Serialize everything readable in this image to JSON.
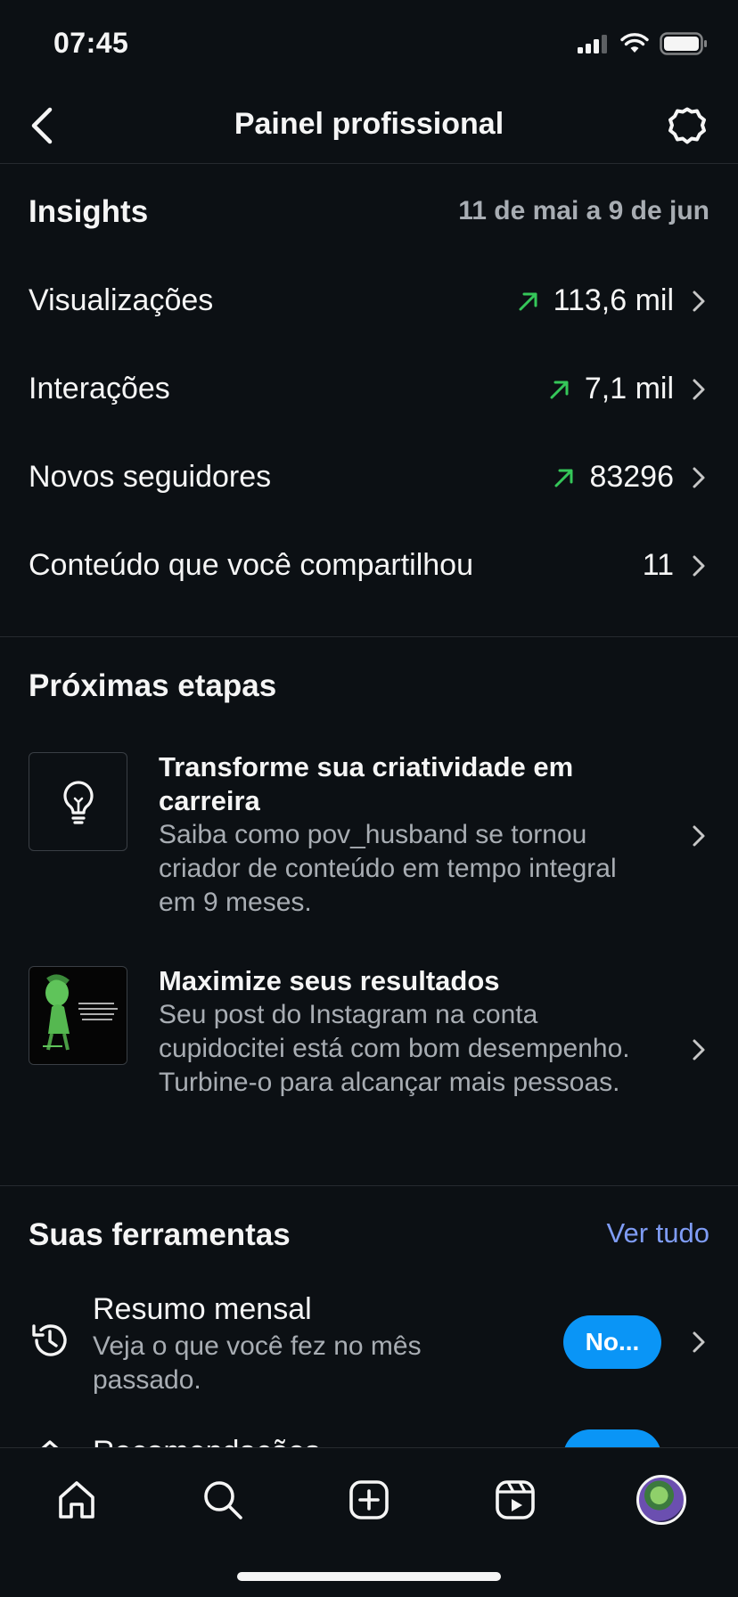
{
  "status_bar": {
    "time": "07:45"
  },
  "header": {
    "title": "Painel profissional"
  },
  "insights": {
    "heading": "Insights",
    "date_range": "11 de mai a 9 de jun",
    "metrics": [
      {
        "label": "Visualizações",
        "value": "113,6 mil",
        "trend": "up"
      },
      {
        "label": "Interações",
        "value": "7,1 mil",
        "trend": "up"
      },
      {
        "label": "Novos seguidores",
        "value": "83296",
        "trend": "up"
      },
      {
        "label": "Conteúdo que você compartilhou",
        "value": "11",
        "trend": "none"
      }
    ]
  },
  "next_steps": {
    "heading": "Próximas etapas",
    "cards": [
      {
        "title": "Transforme sua criatividade em carreira",
        "description": "Saiba como pov_husband se tornou criador de conteúdo em tempo integral em 9 meses.",
        "icon": "lightbulb-icon"
      },
      {
        "title": "Maximize seus resultados",
        "description": "Seu post do Instagram na conta cupidocitei está com bom desempenho. Turbine-o para alcançar mais pessoas.",
        "icon": "post-thumbnail"
      }
    ]
  },
  "tools": {
    "heading": "Suas ferramentas",
    "see_all": "Ver tudo",
    "items": [
      {
        "title": "Resumo mensal",
        "description": "Veja o que você fez no mês passado.",
        "badge": "No...",
        "icon": "history-icon"
      },
      {
        "title": "Recomendações",
        "badge": "No...",
        "icon": "partial-icon"
      }
    ]
  },
  "colors": {
    "background": "#0c1014",
    "trend_up": "#35c759",
    "link": "#7f9cf5",
    "badge": "#0a95f6"
  }
}
